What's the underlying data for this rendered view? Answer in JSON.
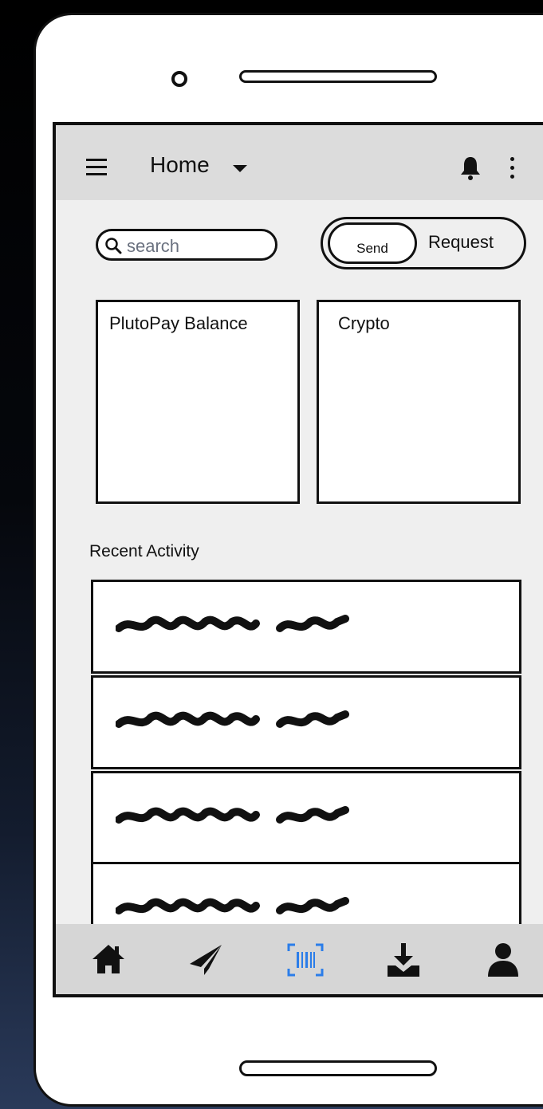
{
  "appbar": {
    "title": "Home"
  },
  "search": {
    "placeholder": "search"
  },
  "toggle": {
    "send_label": "Send",
    "request_label": "Request",
    "selected": "Send"
  },
  "cards": {
    "balance_title": "PlutoPay Balance",
    "crypto_title": "Crypto"
  },
  "activity": {
    "title": "Recent Activity",
    "row_count": 4
  },
  "bottom_nav": {
    "items": [
      "home-icon",
      "send-icon",
      "barcode-scan-icon",
      "download-icon",
      "profile-icon"
    ],
    "active": "barcode-scan-icon",
    "active_color": "#2b7de9"
  }
}
